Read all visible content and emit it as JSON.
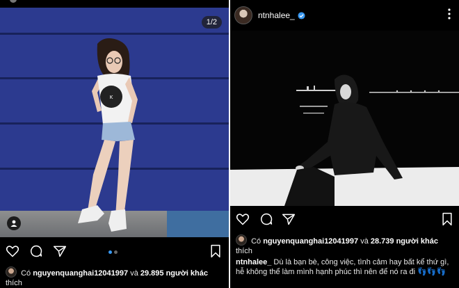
{
  "left_post": {
    "page_indicator": "1/2",
    "likes_prefix": "Có",
    "likes_user": "nguyenquanghai12041997",
    "likes_connector": "và",
    "likes_count": "29.895 người khác",
    "likes_suffix": "thích"
  },
  "right_post": {
    "username": "ntnhalee_",
    "likes_prefix": "Có",
    "likes_user": "nguyenquanghai12041997",
    "likes_connector": "và",
    "likes_count": "28.739 người khác",
    "likes_suffix": "thích",
    "caption_user": "ntnhalee_",
    "caption_text": "Dù là bạn bè, công việc, tình cảm hay bất kể thứ gì, hễ không thể làm mình hạnh phúc thì nên để nó ra đi",
    "caption_emoji": "👣👣👣"
  },
  "colors": {
    "background": "#000000",
    "text": "#f2f2f2",
    "accent": "#3897f0",
    "wall": "#2c3a8f"
  },
  "icons": [
    "heart-icon",
    "comment-icon",
    "share-icon",
    "bookmark-icon",
    "more-icon",
    "verified-icon",
    "user-tag-icon"
  ]
}
